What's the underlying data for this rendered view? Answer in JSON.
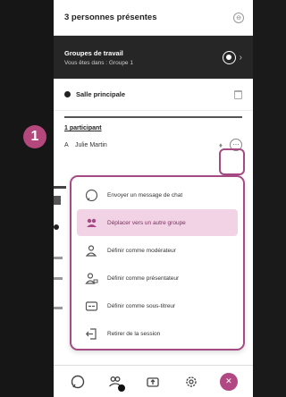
{
  "step": {
    "number": "1"
  },
  "header": {
    "title": "3 personnes présentes"
  },
  "groups": {
    "title": "Groupes de travail",
    "subtitle": "Vous êtes dans : Groupe 1"
  },
  "section": {
    "label": "Salle principale"
  },
  "participants": {
    "count_label": "1 participant",
    "initial": "A",
    "name": "Julie Martin"
  },
  "menu": {
    "items": [
      {
        "label": "Envoyer un message de chat",
        "icon": "chat-icon"
      },
      {
        "label": "Déplacer vers un autre groupe",
        "icon": "move-group-icon"
      },
      {
        "label": "Définir comme modérateur",
        "icon": "moderator-icon"
      },
      {
        "label": "Définir comme présentateur",
        "icon": "presenter-icon"
      },
      {
        "label": "Définir comme sous-titreur",
        "icon": "captioner-icon"
      },
      {
        "label": "Retirer de la session",
        "icon": "remove-icon"
      }
    ]
  },
  "colors": {
    "accent": "#a64a84",
    "highlight": "#f1d3e5",
    "dark": "#262626"
  },
  "bottom_bar": {
    "icons": [
      "chat-icon",
      "attendees-icon",
      "share-content-icon",
      "settings-icon",
      "close-icon"
    ]
  }
}
